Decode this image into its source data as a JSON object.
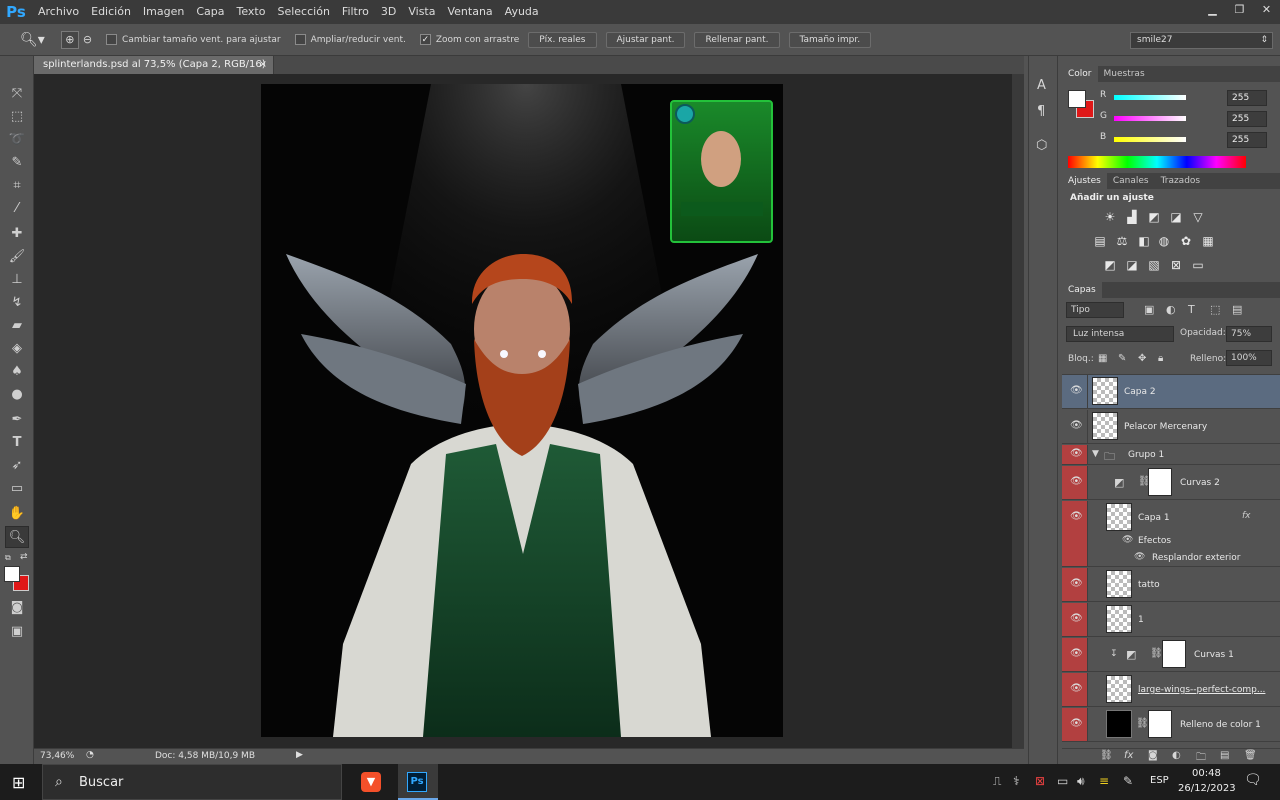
{
  "app": {
    "logo": "Ps"
  },
  "menu": [
    "Archivo",
    "Edición",
    "Imagen",
    "Capa",
    "Texto",
    "Selección",
    "Filtro",
    "3D",
    "Vista",
    "Ventana",
    "Ayuda"
  ],
  "window_controls": [
    "minimize-icon",
    "restore-icon",
    "close-icon"
  ],
  "options": {
    "resize_windows": "Cambiar tamaño vent. para ajustar",
    "zoom_all": "Ampliar/reducir vent.",
    "scrubby_zoom": "Zoom con arrastre",
    "btn_actual": "Píx. reales",
    "btn_fit": "Ajustar pant.",
    "btn_fill": "Rellenar pant.",
    "btn_print": "Tamaño impr.",
    "workspace": "smile27"
  },
  "document": {
    "tab_title": "splinterlands.psd al 73,5% (Capa 2, RGB/16) *",
    "close": "×"
  },
  "status": {
    "zoom": "73,46%",
    "doc": "Doc: 4,58 MB/10,9 MB"
  },
  "color_panel": {
    "tabs": [
      "Color",
      "Muestras"
    ],
    "r_label": "R",
    "g_label": "G",
    "b_label": "B",
    "r": "255",
    "g": "255",
    "b": "255"
  },
  "adjustments": {
    "tabs": [
      "Ajustes",
      "Canales",
      "Trazados"
    ],
    "title": "Añadir un ajuste"
  },
  "layers_panel": {
    "tab": "Capas",
    "filter": "Tipo",
    "blend_mode": "Luz intensa",
    "opacity_label": "Opacidad:",
    "opacity": "75%",
    "lock_label": "Bloq.:",
    "fill_label": "Relleno:",
    "fill": "100%",
    "layers": [
      {
        "name": "Capa 2"
      },
      {
        "name": "Pelacor Mercenary"
      },
      {
        "name": "Grupo 1"
      },
      {
        "name": "Curvas 2"
      },
      {
        "name": "Capa 1",
        "fx": "fx"
      },
      {
        "name": "Efectos"
      },
      {
        "name": "Resplandor exterior"
      },
      {
        "name": "tatto"
      },
      {
        "name": "1"
      },
      {
        "name": "Curvas 1"
      },
      {
        "name": "large-wings--perfect-comp..."
      },
      {
        "name": "Relleno de color 1"
      }
    ]
  },
  "taskbar": {
    "search": "Buscar",
    "lang": "ESP",
    "time": "00:48",
    "date": "26/12/2023"
  },
  "colors": {
    "accent_blue": "#31a8ff",
    "selected_layer": "#5b6b80",
    "group_red": "#b24040"
  }
}
